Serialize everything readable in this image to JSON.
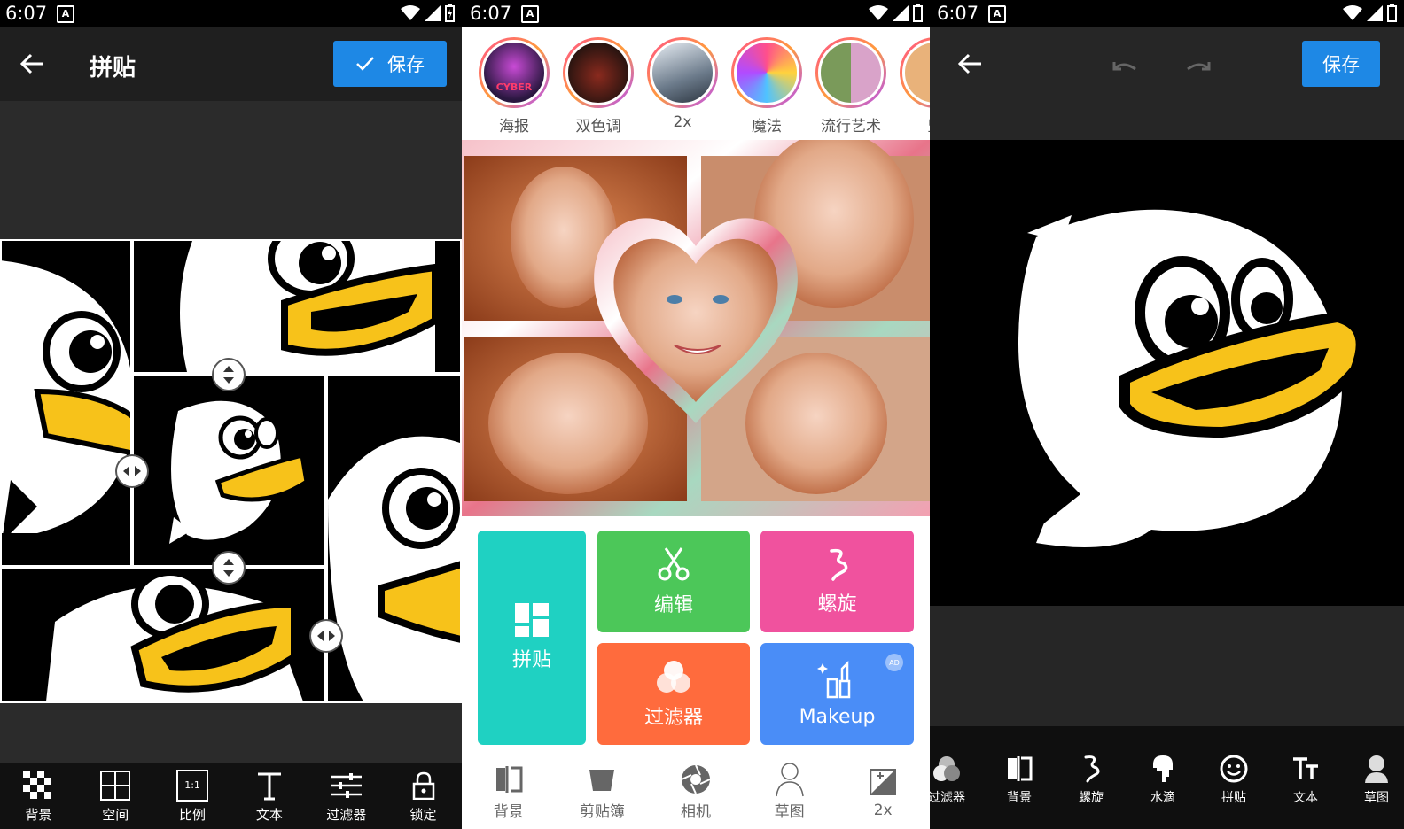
{
  "status": {
    "time": "6:07",
    "a_icon": "A"
  },
  "panel1": {
    "title": "拼贴",
    "save_label": "保存",
    "tools": [
      {
        "label": "背景",
        "icon": "checkerboard-icon"
      },
      {
        "label": "空间",
        "icon": "grid-icon"
      },
      {
        "label": "比例",
        "icon": "ratio-icon"
      },
      {
        "label": "文本",
        "icon": "text-icon"
      },
      {
        "label": "过滤器",
        "icon": "sliders-icon"
      },
      {
        "label": "锁定",
        "icon": "lock-icon"
      }
    ],
    "ratio_text": "1:1",
    "colors": {
      "toolbar": "#1f1f1f",
      "save": "#1e88e5",
      "duck_bill": "#f7c21a"
    }
  },
  "panel2": {
    "effects": [
      {
        "label": "海报"
      },
      {
        "label": "双色调"
      },
      {
        "label": "2x"
      },
      {
        "label": "魔法"
      },
      {
        "label": "流行艺术"
      },
      {
        "label": "坚"
      }
    ],
    "cyber_text": "CYBER",
    "tiles": {
      "collage": "拼贴",
      "edit": "编辑",
      "spiral": "螺旋",
      "filter": "过滤器",
      "makeup": "Makeup",
      "ad": "AD"
    },
    "bottom": [
      {
        "label": "背景",
        "icon": "background-icon"
      },
      {
        "label": "剪贴簿",
        "icon": "scrapbook-icon"
      },
      {
        "label": "相机",
        "icon": "camera-aperture-icon"
      },
      {
        "label": "草图",
        "icon": "sketch-icon"
      },
      {
        "label": "2x",
        "icon": "enhance-icon"
      }
    ],
    "colors": {
      "teal": "#1fd1c2",
      "green": "#4cc759",
      "pink": "#f0529e",
      "orange": "#ff6b3d",
      "blue": "#4a8df7"
    }
  },
  "panel3": {
    "save_label": "保存",
    "tools": [
      {
        "label": "过滤器",
        "icon": "filter-icon"
      },
      {
        "label": "背景",
        "icon": "background-icon"
      },
      {
        "label": "螺旋",
        "icon": "spiral-icon"
      },
      {
        "label": "水滴",
        "icon": "drip-icon"
      },
      {
        "label": "拼贴",
        "icon": "smiley-icon"
      },
      {
        "label": "文本",
        "icon": "text-icon"
      },
      {
        "label": "草图",
        "icon": "sketch-icon"
      }
    ]
  }
}
